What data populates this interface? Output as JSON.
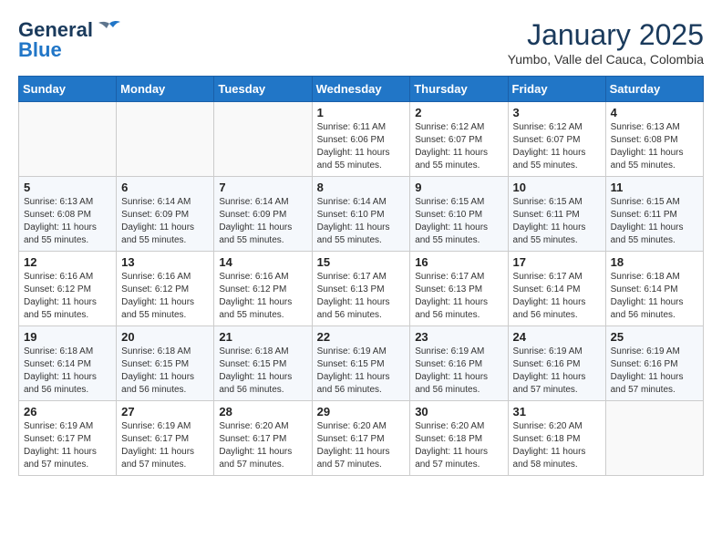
{
  "header": {
    "logo": {
      "line1": "General",
      "line2": "Blue"
    },
    "title": "January 2025",
    "location": "Yumbo, Valle del Cauca, Colombia"
  },
  "weekdays": [
    "Sunday",
    "Monday",
    "Tuesday",
    "Wednesday",
    "Thursday",
    "Friday",
    "Saturday"
  ],
  "weeks": [
    [
      {
        "day": "",
        "info": ""
      },
      {
        "day": "",
        "info": ""
      },
      {
        "day": "",
        "info": ""
      },
      {
        "day": "1",
        "info": "Sunrise: 6:11 AM\nSunset: 6:06 PM\nDaylight: 11 hours\nand 55 minutes."
      },
      {
        "day": "2",
        "info": "Sunrise: 6:12 AM\nSunset: 6:07 PM\nDaylight: 11 hours\nand 55 minutes."
      },
      {
        "day": "3",
        "info": "Sunrise: 6:12 AM\nSunset: 6:07 PM\nDaylight: 11 hours\nand 55 minutes."
      },
      {
        "day": "4",
        "info": "Sunrise: 6:13 AM\nSunset: 6:08 PM\nDaylight: 11 hours\nand 55 minutes."
      }
    ],
    [
      {
        "day": "5",
        "info": "Sunrise: 6:13 AM\nSunset: 6:08 PM\nDaylight: 11 hours\nand 55 minutes."
      },
      {
        "day": "6",
        "info": "Sunrise: 6:14 AM\nSunset: 6:09 PM\nDaylight: 11 hours\nand 55 minutes."
      },
      {
        "day": "7",
        "info": "Sunrise: 6:14 AM\nSunset: 6:09 PM\nDaylight: 11 hours\nand 55 minutes."
      },
      {
        "day": "8",
        "info": "Sunrise: 6:14 AM\nSunset: 6:10 PM\nDaylight: 11 hours\nand 55 minutes."
      },
      {
        "day": "9",
        "info": "Sunrise: 6:15 AM\nSunset: 6:10 PM\nDaylight: 11 hours\nand 55 minutes."
      },
      {
        "day": "10",
        "info": "Sunrise: 6:15 AM\nSunset: 6:11 PM\nDaylight: 11 hours\nand 55 minutes."
      },
      {
        "day": "11",
        "info": "Sunrise: 6:15 AM\nSunset: 6:11 PM\nDaylight: 11 hours\nand 55 minutes."
      }
    ],
    [
      {
        "day": "12",
        "info": "Sunrise: 6:16 AM\nSunset: 6:12 PM\nDaylight: 11 hours\nand 55 minutes."
      },
      {
        "day": "13",
        "info": "Sunrise: 6:16 AM\nSunset: 6:12 PM\nDaylight: 11 hours\nand 55 minutes."
      },
      {
        "day": "14",
        "info": "Sunrise: 6:16 AM\nSunset: 6:12 PM\nDaylight: 11 hours\nand 55 minutes."
      },
      {
        "day": "15",
        "info": "Sunrise: 6:17 AM\nSunset: 6:13 PM\nDaylight: 11 hours\nand 56 minutes."
      },
      {
        "day": "16",
        "info": "Sunrise: 6:17 AM\nSunset: 6:13 PM\nDaylight: 11 hours\nand 56 minutes."
      },
      {
        "day": "17",
        "info": "Sunrise: 6:17 AM\nSunset: 6:14 PM\nDaylight: 11 hours\nand 56 minutes."
      },
      {
        "day": "18",
        "info": "Sunrise: 6:18 AM\nSunset: 6:14 PM\nDaylight: 11 hours\nand 56 minutes."
      }
    ],
    [
      {
        "day": "19",
        "info": "Sunrise: 6:18 AM\nSunset: 6:14 PM\nDaylight: 11 hours\nand 56 minutes."
      },
      {
        "day": "20",
        "info": "Sunrise: 6:18 AM\nSunset: 6:15 PM\nDaylight: 11 hours\nand 56 minutes."
      },
      {
        "day": "21",
        "info": "Sunrise: 6:18 AM\nSunset: 6:15 PM\nDaylight: 11 hours\nand 56 minutes."
      },
      {
        "day": "22",
        "info": "Sunrise: 6:19 AM\nSunset: 6:15 PM\nDaylight: 11 hours\nand 56 minutes."
      },
      {
        "day": "23",
        "info": "Sunrise: 6:19 AM\nSunset: 6:16 PM\nDaylight: 11 hours\nand 56 minutes."
      },
      {
        "day": "24",
        "info": "Sunrise: 6:19 AM\nSunset: 6:16 PM\nDaylight: 11 hours\nand 57 minutes."
      },
      {
        "day": "25",
        "info": "Sunrise: 6:19 AM\nSunset: 6:16 PM\nDaylight: 11 hours\nand 57 minutes."
      }
    ],
    [
      {
        "day": "26",
        "info": "Sunrise: 6:19 AM\nSunset: 6:17 PM\nDaylight: 11 hours\nand 57 minutes."
      },
      {
        "day": "27",
        "info": "Sunrise: 6:19 AM\nSunset: 6:17 PM\nDaylight: 11 hours\nand 57 minutes."
      },
      {
        "day": "28",
        "info": "Sunrise: 6:20 AM\nSunset: 6:17 PM\nDaylight: 11 hours\nand 57 minutes."
      },
      {
        "day": "29",
        "info": "Sunrise: 6:20 AM\nSunset: 6:17 PM\nDaylight: 11 hours\nand 57 minutes."
      },
      {
        "day": "30",
        "info": "Sunrise: 6:20 AM\nSunset: 6:18 PM\nDaylight: 11 hours\nand 57 minutes."
      },
      {
        "day": "31",
        "info": "Sunrise: 6:20 AM\nSunset: 6:18 PM\nDaylight: 11 hours\nand 58 minutes."
      },
      {
        "day": "",
        "info": ""
      }
    ]
  ]
}
